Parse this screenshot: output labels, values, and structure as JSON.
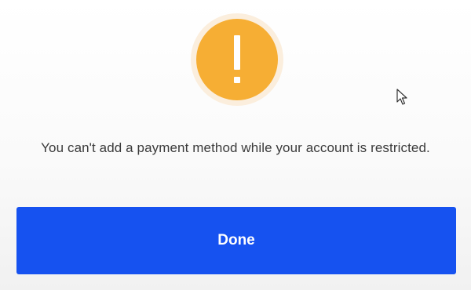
{
  "dialog": {
    "icon": "exclamation-warning-icon",
    "icon_glyph": "!",
    "message": "You can't add a payment method while your account is restricted.",
    "done_label": "Done"
  },
  "colors": {
    "warning": "#f6ae34",
    "warning_halo": "#fbeedd",
    "primary_button": "#1652f0",
    "text": "#3b3b3b"
  },
  "cursor_icon": "mouse-pointer-icon"
}
